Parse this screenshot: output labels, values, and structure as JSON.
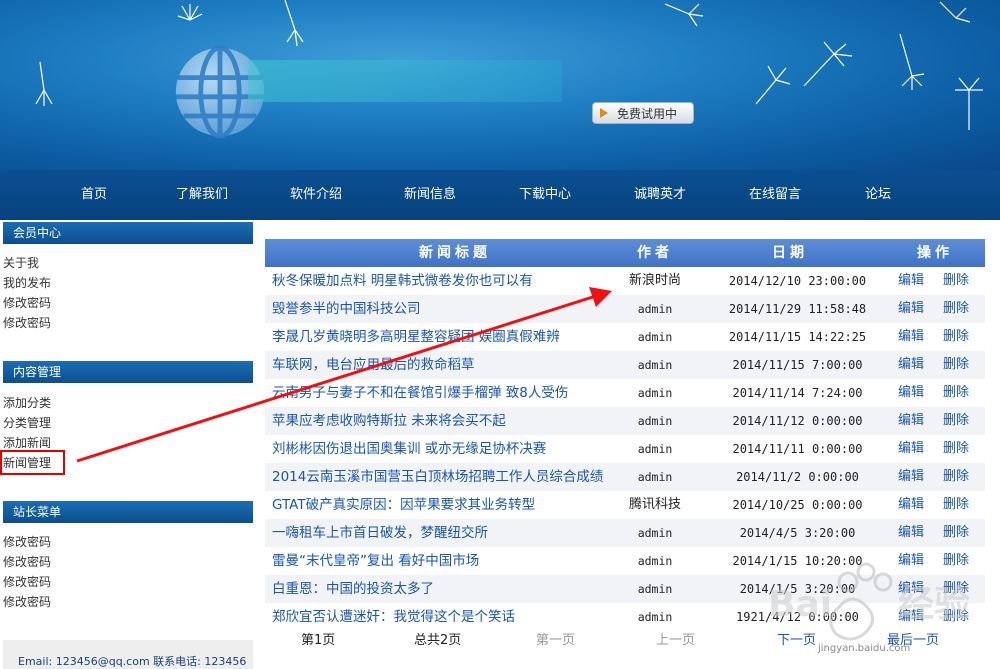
{
  "banner": {
    "trial_button": "免费试用中",
    "colors": {
      "banner": "#1f7fc4",
      "nav": "#0a4f92"
    }
  },
  "nav": {
    "items": [
      "首页",
      "了解我们",
      "软件介绍",
      "新闻信息",
      "下载中心",
      "诚聘英才",
      "在线留言",
      "论坛"
    ]
  },
  "sidebar": {
    "member": {
      "title": "会员中心",
      "links": [
        "关于我",
        "我的发布",
        "修改密码",
        "修改密码"
      ]
    },
    "content": {
      "title": "内容管理",
      "links": [
        "添加分类",
        "分类管理",
        "添加新闻",
        "新闻管理"
      ]
    },
    "admin": {
      "title": "站长菜单",
      "links": [
        "修改密码",
        "修改密码",
        "修改密码",
        "修改密码"
      ]
    },
    "footer": "Email: 123456@qq.com 联系电话: 123456"
  },
  "table": {
    "headers": [
      "新闻标题",
      "作者",
      "日期",
      "操作"
    ],
    "rows": [
      {
        "title": "秋冬保暖加点料 明星韩式微卷发你也可以有",
        "author": "新浪时尚",
        "date": "2014/12/10 23:00:00",
        "edit": "编辑",
        "delete": "删除"
      },
      {
        "title": "毁誉参半的中国科技公司",
        "author": "admin",
        "date": "2014/11/29 11:58:48",
        "edit": "编辑",
        "delete": "删除"
      },
      {
        "title": "李晟几岁黄晓明多高明星整容疑团 娱圈真假难辨",
        "author": "admin",
        "date": "2014/11/15 14:22:25",
        "edit": "编辑",
        "delete": "删除"
      },
      {
        "title": "车联网，电台应用最后的救命稻草",
        "author": "admin",
        "date": "2014/11/15 7:00:00",
        "edit": "编辑",
        "delete": "删除"
      },
      {
        "title": "云南男子与妻子不和在餐馆引爆手榴弹 致8人受伤",
        "author": "admin",
        "date": "2014/11/14 7:24:00",
        "edit": "编辑",
        "delete": "删除"
      },
      {
        "title": "苹果应考虑收购特斯拉 未来将会买不起",
        "author": "admin",
        "date": "2014/11/12 0:00:00",
        "edit": "编辑",
        "delete": "删除"
      },
      {
        "title": "刘彬彬因伤退出国奥集训 或亦无缘足协杯决赛",
        "author": "admin",
        "date": "2014/11/11 0:00:00",
        "edit": "编辑",
        "delete": "删除"
      },
      {
        "title": "2014云南玉溪市国营玉白顶林场招聘工作人员综合成绩",
        "author": "admin",
        "date": "2014/11/2 0:00:00",
        "edit": "编辑",
        "delete": "删除"
      },
      {
        "title": "GTAT破产真实原因：因苹果要求其业务转型",
        "author": "腾讯科技",
        "date": "2014/10/25 0:00:00",
        "edit": "编辑",
        "delete": "删除"
      },
      {
        "title": "一嗨租车上市首日破发，梦醒纽交所",
        "author": "admin",
        "date": "2014/4/5 3:20:00",
        "edit": "编辑",
        "delete": "删除"
      },
      {
        "title": "雷曼“末代皇帝”复出 看好中国市场",
        "author": "admin",
        "date": "2014/1/15 10:20:00",
        "edit": "编辑",
        "delete": "删除"
      },
      {
        "title": "白重恩：中国的投资太多了",
        "author": "admin",
        "date": "2014/1/5 3:20:00",
        "edit": "编辑",
        "delete": "删除"
      },
      {
        "title": "郑欣宜否认遭迷奸：我觉得这个是个笑话",
        "author": "admin",
        "date": "1921/4/12 0:00:00",
        "edit": "编辑",
        "delete": "删除"
      }
    ]
  },
  "pager": {
    "current": "第1页",
    "total": "总共2页",
    "first": "第一页",
    "prev": "上一页",
    "next": "下一页",
    "last": "最后一页"
  },
  "watermark": {
    "text": "jingyan.baidu.com"
  }
}
